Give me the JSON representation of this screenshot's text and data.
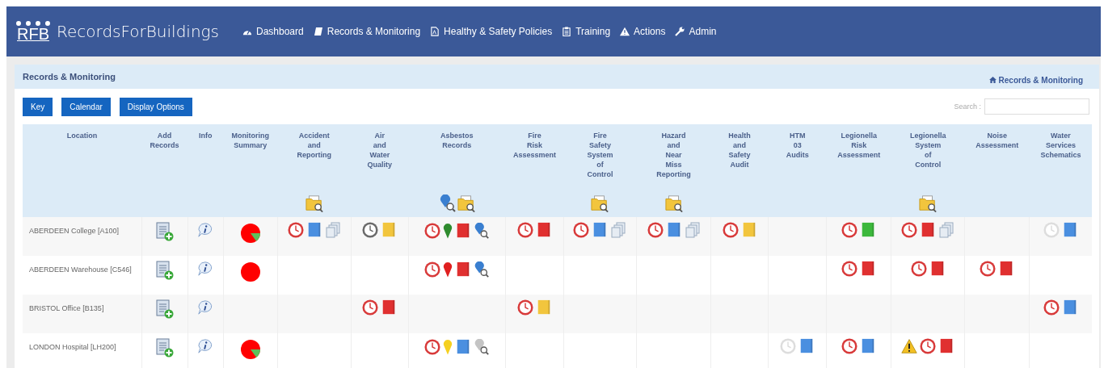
{
  "brand": {
    "mark": "RFB",
    "name": "RecordsForBuildings"
  },
  "nav": [
    {
      "kind": "dashboard",
      "label": "Dashboard"
    },
    {
      "kind": "book",
      "label": "Records & Monitoring"
    },
    {
      "kind": "pdf",
      "label": "Healthy & Safety Policies"
    },
    {
      "kind": "clipboard",
      "label": "Training"
    },
    {
      "kind": "warning",
      "label": "Actions"
    },
    {
      "kind": "wrench",
      "label": "Admin"
    }
  ],
  "panel": {
    "title": "Records & Monitoring",
    "breadcrumb": "Records & Monitoring"
  },
  "buttons": [
    "Key",
    "Calendar",
    "Display Options"
  ],
  "search": {
    "label": "Search :"
  },
  "columns": [
    {
      "kind": "location",
      "label": "Location"
    },
    {
      "kind": "add",
      "label": "Add\nRecords"
    },
    {
      "kind": "info",
      "label": "Info"
    },
    {
      "kind": "summary",
      "label": "Monitoring\nSummary"
    },
    {
      "kind": "record",
      "label": "Accident\nand\nReporting",
      "header_icons": [
        {
          "kind": "folder-search"
        }
      ]
    },
    {
      "kind": "record",
      "label": "Air\nand\nWater\nQuality"
    },
    {
      "kind": "record",
      "label": "Asbestos\nRecords",
      "header_icons": [
        {
          "kind": "search-pin"
        },
        {
          "kind": "folder-search"
        }
      ]
    },
    {
      "kind": "record",
      "label": "Fire\nRisk\nAssessment"
    },
    {
      "kind": "record",
      "label": "Fire\nSafety\nSystem\nof\nControl",
      "header_icons": [
        {
          "kind": "folder-search"
        }
      ]
    },
    {
      "kind": "record",
      "label": "Hazard\nand\nNear\nMiss\nReporting",
      "header_icons": [
        {
          "kind": "folder-search"
        }
      ]
    },
    {
      "kind": "record",
      "label": "Health\nand\nSafety\nAudit"
    },
    {
      "kind": "record",
      "label": "HTM\n03\nAudits"
    },
    {
      "kind": "record",
      "label": "Legionella\nRisk\nAssessment"
    },
    {
      "kind": "record",
      "label": "Legionella\nSystem\nof\nControl",
      "header_icons": [
        {
          "kind": "folder-search"
        }
      ]
    },
    {
      "kind": "record",
      "label": "Noise\nAssessment"
    },
    {
      "kind": "record",
      "label": "Water\nServices\nSchematics"
    }
  ],
  "rows": [
    {
      "location": "ABERDEEN College [A100]",
      "summary": {
        "green_slice": true
      },
      "cells": [
        [
          {
            "kind": "clock",
            "color": "#d83a3a"
          },
          {
            "kind": "book",
            "color": "#4a8fe0"
          },
          {
            "kind": "stack"
          }
        ],
        [
          {
            "kind": "clock",
            "color": "#6a6a6a"
          },
          {
            "kind": "book",
            "color": "#f2c53d"
          }
        ],
        [
          {
            "kind": "clock",
            "color": "#d83a3a"
          },
          {
            "kind": "pin",
            "color": "#2e8b2e"
          },
          {
            "kind": "book",
            "color": "#e03030"
          },
          {
            "kind": "search-pin",
            "color": "#3a7fd0"
          }
        ],
        [
          {
            "kind": "clock",
            "color": "#d83a3a"
          },
          {
            "kind": "book",
            "color": "#e03030"
          }
        ],
        [
          {
            "kind": "clock",
            "color": "#d83a3a"
          },
          {
            "kind": "book",
            "color": "#4a8fe0"
          },
          {
            "kind": "stack"
          }
        ],
        [
          {
            "kind": "clock",
            "color": "#d83a3a"
          },
          {
            "kind": "book",
            "color": "#4a8fe0"
          },
          {
            "kind": "stack"
          }
        ],
        [
          {
            "kind": "clock",
            "color": "#d83a3a"
          },
          {
            "kind": "book",
            "color": "#f2c53d"
          }
        ],
        [],
        [
          {
            "kind": "clock",
            "color": "#d83a3a"
          },
          {
            "kind": "book",
            "color": "#3cb83c"
          }
        ],
        [
          {
            "kind": "clock",
            "color": "#d83a3a"
          },
          {
            "kind": "book",
            "color": "#e03030"
          },
          {
            "kind": "stack"
          }
        ],
        [],
        [
          {
            "kind": "clock",
            "color": "#dddddd"
          },
          {
            "kind": "book",
            "color": "#4a8fe0"
          }
        ]
      ]
    },
    {
      "location": "ABERDEEN Warehouse [C546]",
      "summary": {
        "green_slice": false
      },
      "cells": [
        [],
        [],
        [
          {
            "kind": "clock",
            "color": "#d83a3a"
          },
          {
            "kind": "pin",
            "color": "#e02020"
          },
          {
            "kind": "book",
            "color": "#e03030"
          },
          {
            "kind": "search-pin",
            "color": "#3a7fd0"
          }
        ],
        [],
        [],
        [],
        [],
        [],
        [
          {
            "kind": "clock",
            "color": "#d83a3a"
          },
          {
            "kind": "book",
            "color": "#e03030"
          }
        ],
        [
          {
            "kind": "clock",
            "color": "#d83a3a"
          },
          {
            "kind": "book",
            "color": "#e03030"
          }
        ],
        [
          {
            "kind": "clock",
            "color": "#d83a3a"
          },
          {
            "kind": "book",
            "color": "#e03030"
          }
        ],
        []
      ]
    },
    {
      "location": "BRISTOL Office [B135]",
      "cells": [
        [],
        [
          {
            "kind": "clock",
            "color": "#d83a3a"
          },
          {
            "kind": "book",
            "color": "#e03030"
          }
        ],
        [],
        [
          {
            "kind": "clock",
            "color": "#d83a3a"
          },
          {
            "kind": "book",
            "color": "#f2c53d"
          }
        ],
        [],
        [],
        [],
        [],
        [],
        [],
        [],
        [
          {
            "kind": "clock",
            "color": "#d83a3a"
          },
          {
            "kind": "book",
            "color": "#4a8fe0"
          }
        ]
      ]
    },
    {
      "location": "LONDON Hospital [LH200]",
      "summary": {
        "green_slice": true
      },
      "cells": [
        [],
        [],
        [
          {
            "kind": "clock",
            "color": "#d83a3a"
          },
          {
            "kind": "pin",
            "color": "#f5d020"
          },
          {
            "kind": "book",
            "color": "#4a8fe0"
          },
          {
            "kind": "search-pin",
            "color": "#c4c4c4"
          }
        ],
        [],
        [],
        [],
        [],
        [
          {
            "kind": "clock",
            "color": "#dddddd"
          },
          {
            "kind": "book",
            "color": "#4a8fe0"
          }
        ],
        [
          {
            "kind": "clock",
            "color": "#d83a3a"
          },
          {
            "kind": "book",
            "color": "#4a8fe0"
          }
        ],
        [
          {
            "kind": "warning"
          },
          {
            "kind": "clock",
            "color": "#d83a3a"
          },
          {
            "kind": "book",
            "color": "#e03030"
          }
        ],
        [],
        []
      ]
    }
  ]
}
